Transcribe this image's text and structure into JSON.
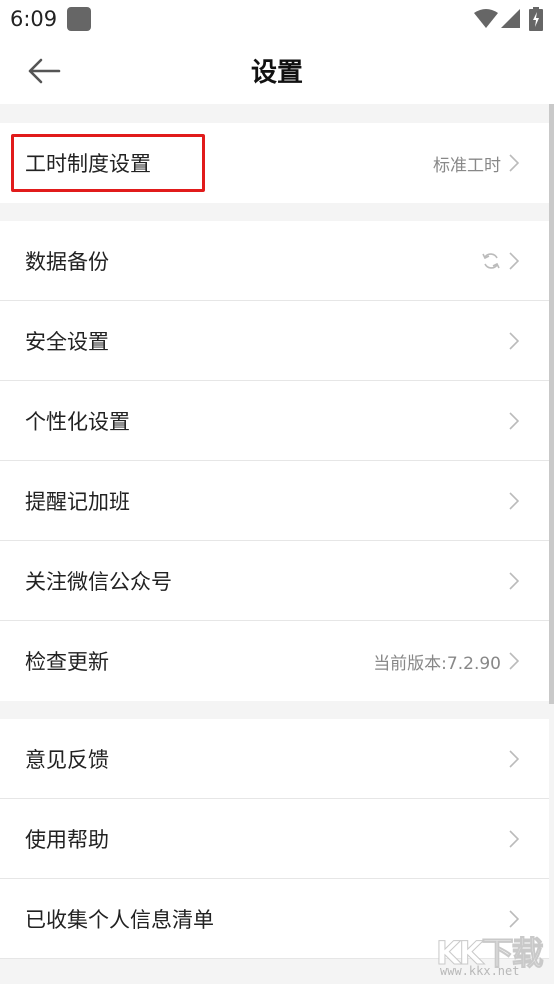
{
  "status_bar": {
    "time": "6:09"
  },
  "app_bar": {
    "title": "设置",
    "back_icon": "arrow-left-icon"
  },
  "groups": [
    {
      "items": [
        {
          "label": "工时制度设置",
          "value": "标准工时",
          "icon": "chevron-right-icon"
        }
      ]
    },
    {
      "items": [
        {
          "label": "数据备份",
          "value": "",
          "status_icon": "sync-icon",
          "icon": "chevron-right-icon"
        },
        {
          "label": "安全设置",
          "value": "",
          "icon": "chevron-right-icon"
        },
        {
          "label": "个性化设置",
          "value": "",
          "icon": "chevron-right-icon"
        },
        {
          "label": "提醒记加班",
          "value": "",
          "icon": "chevron-right-icon"
        },
        {
          "label": "关注微信公众号",
          "value": "",
          "icon": "chevron-right-icon"
        },
        {
          "label": "检查更新",
          "value": "当前版本:7.2.90",
          "icon": "chevron-right-icon"
        }
      ]
    },
    {
      "items": [
        {
          "label": "意见反馈",
          "value": "",
          "icon": "chevron-right-icon"
        },
        {
          "label": "使用帮助",
          "value": "",
          "icon": "chevron-right-icon"
        },
        {
          "label": "已收集个人信息清单",
          "value": "",
          "icon": "chevron-right-icon"
        }
      ]
    }
  ],
  "watermark": {
    "text": "KK下载",
    "url": "www.kkx.net"
  },
  "colors": {
    "highlight": "#e11b1b",
    "background": "#f4f4f4",
    "row_background": "#ffffff",
    "secondary_text": "#888888"
  }
}
